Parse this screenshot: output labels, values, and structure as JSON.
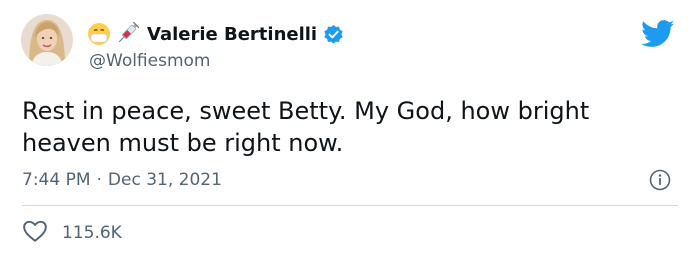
{
  "author": {
    "display_name": "Valerie Bertinelli",
    "handle": "@Wolfiesmom",
    "emojis": [
      "face-with-medical-mask",
      "syringe"
    ],
    "verified": true
  },
  "tweet": {
    "text": "Rest in peace, sweet Betty. My God, how bright heaven must be right now.",
    "time": "7:44 PM",
    "separator": "·",
    "date": "Dec 31, 2021"
  },
  "engagement": {
    "likes": "115.6K"
  },
  "icons": {
    "brand": "twitter-bird-icon",
    "info": "info-icon",
    "like": "heart-icon",
    "verified": "verified-badge-icon"
  },
  "colors": {
    "twitter_blue": "#1d9bf0",
    "text_primary": "#0f1419",
    "text_secondary": "#536471",
    "divider": "#cfd9de"
  }
}
